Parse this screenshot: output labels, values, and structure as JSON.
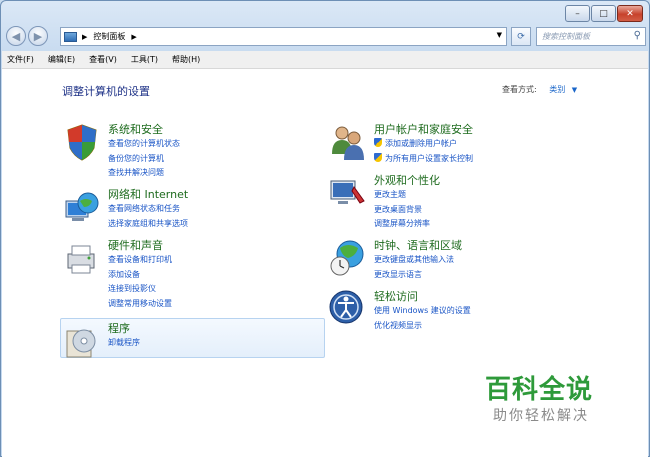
{
  "window": {
    "caption_buttons": {
      "minimize": "–",
      "maximize": "□",
      "close": "✕"
    }
  },
  "address": {
    "path": "控制面板",
    "search_placeholder": "搜索控制面板"
  },
  "menu": [
    "文件(F)",
    "编辑(E)",
    "查看(V)",
    "工具(T)",
    "帮助(H)"
  ],
  "main": {
    "title": "调整计算机的设置",
    "view_by_label": "查看方式:",
    "view_by_value": "类别"
  },
  "categories": {
    "system": {
      "title": "系统和安全",
      "links": [
        "查看您的计算机状态",
        "备份您的计算机",
        "查找并解决问题"
      ]
    },
    "network": {
      "title": "网络和 Internet",
      "links": [
        "查看网络状态和任务",
        "选择家庭组和共享选项"
      ]
    },
    "hardware": {
      "title": "硬件和声音",
      "links": [
        "查看设备和打印机",
        "添加设备",
        "连接到投影仪",
        "调整常用移动设置"
      ]
    },
    "programs": {
      "title": "程序",
      "links": [
        "卸载程序"
      ]
    },
    "accounts": {
      "title": "用户帐户和家庭安全",
      "links": [
        "添加或删除用户帐户",
        "为所有用户设置家长控制"
      ]
    },
    "appearance": {
      "title": "外观和个性化",
      "links": [
        "更改主题",
        "更改桌面背景",
        "调整屏幕分辨率"
      ]
    },
    "clock": {
      "title": "时钟、语言和区域",
      "links": [
        "更改键盘或其他输入法",
        "更改显示语言"
      ]
    },
    "ease": {
      "title": "轻松访问",
      "links": [
        "使用 Windows 建议的设置",
        "优化视频显示"
      ]
    }
  },
  "watermark": {
    "line1": "百科全说",
    "line2": "助你轻松解决"
  }
}
